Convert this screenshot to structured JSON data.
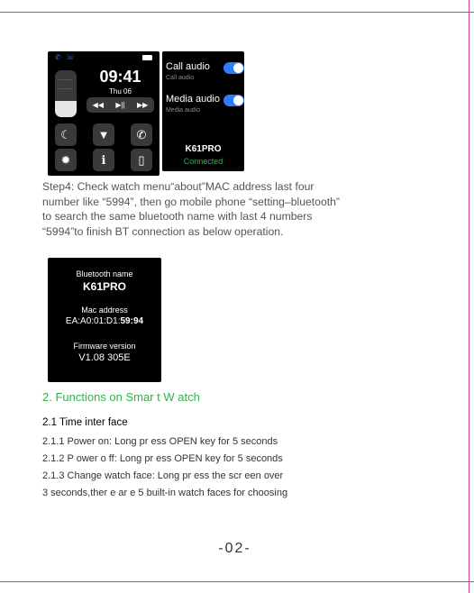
{
  "watch_home": {
    "status_icons": [
      "bluetooth-icon",
      "phone-icon"
    ],
    "time": "09:41",
    "date": "Thu 06",
    "brightness_level": 0.35,
    "media_controls": [
      "◀◀",
      "▶||",
      "▶▶"
    ],
    "tiles": [
      "moon-icon",
      "flashlight-icon",
      "phone-call-icon",
      "gear-icon",
      "info-icon",
      "watch-icon"
    ]
  },
  "watch_audio": {
    "call_audio": "Call audio",
    "call_audio_sub": "Call audio",
    "media_audio": "Media audio",
    "media_audio_sub": "Media audio",
    "device_name": "K61PRO",
    "status": "Connected"
  },
  "step4": {
    "lines": [
      "Step4: Check  watch menu“about”MAC address last four",
      "number like “5994”, then go mobile phone “setting–bluetooth”",
      "to search the same bluetooth name with last 4 numbers",
      "“5994”to finish BT connection as below operation."
    ]
  },
  "about_screen": {
    "bt_label": "Bluetooth name",
    "bt_name": "K61PRO",
    "mac_label": "Mac address",
    "mac_prefix": "EA:A0:01:D1:",
    "mac_suffix": "59:94",
    "fw_label": "Firmware version",
    "fw_value": "V1.08  305E"
  },
  "functions": {
    "title": "2. Functions on Smar   t W atch",
    "subtitle": "2.1 Time inter  face",
    "lines": [
      "2.1.1 Power on: Long pr   ess OPEN key for     5 seconds",
      "2.1.2 P ower o ff: Long pr  ess OPEN key for     5 seconds",
      "2.1.3 Change watch face: Long pr    ess the scr  een over",
      "3 seconds,ther  e ar e  5 built-in watch faces for choosing"
    ]
  },
  "page_number": "-02-",
  "colors": {
    "border": "#d63aa7",
    "heading": "#2fb34a",
    "toggle": "#2d7cff",
    "connected": "#20c040"
  }
}
